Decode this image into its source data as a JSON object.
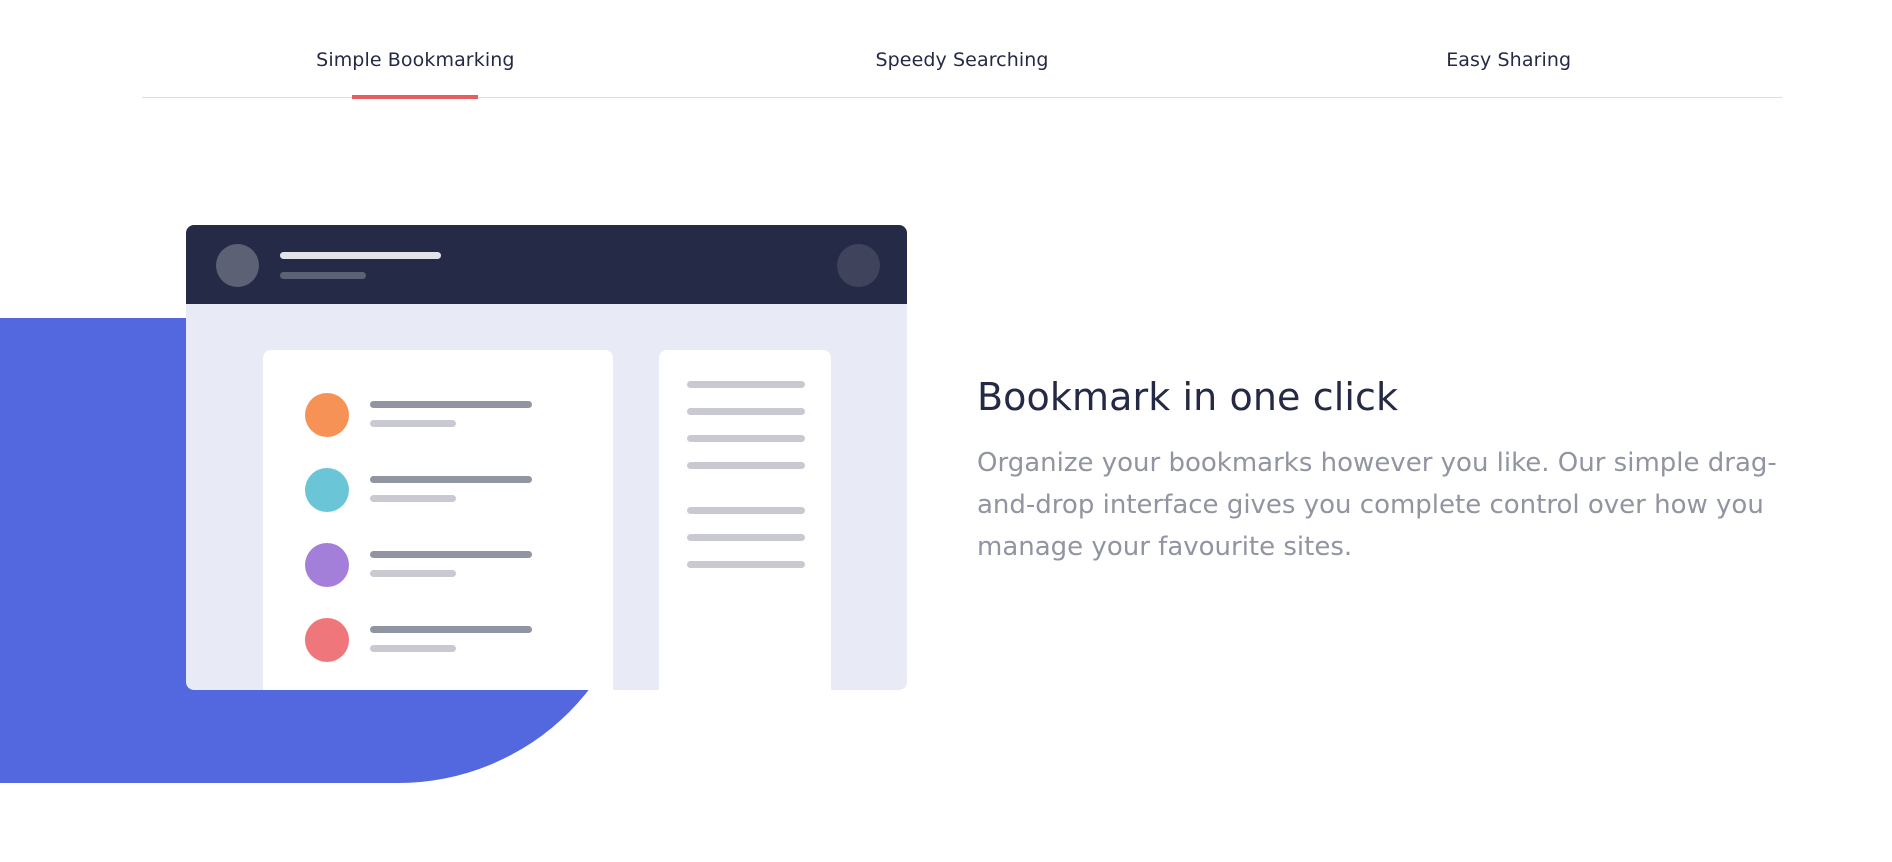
{
  "tabs": [
    {
      "label": "Simple Bookmarking",
      "active": true
    },
    {
      "label": "Speedy Searching",
      "active": false
    },
    {
      "label": "Easy Sharing",
      "active": false
    }
  ],
  "feature": {
    "title": "Bookmark in one click",
    "description": "Organize your bookmarks however you like. Our simple drag-and-drop interface gives you complete control over how you manage your favourite sites."
  },
  "illustration": {
    "item_colors": [
      "#f69256",
      "#6ac6d7",
      "#a47fd9",
      "#ef767a"
    ]
  },
  "colors": {
    "accent": "#e65e5e",
    "primary_blue": "#5368df",
    "dark_navy": "#252b46",
    "muted_text": "#9194a1"
  }
}
